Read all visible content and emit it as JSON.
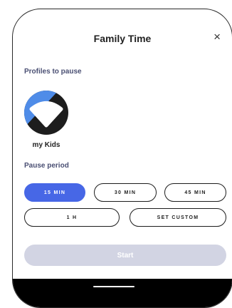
{
  "dialog": {
    "title": "Family Time",
    "close_icon": "×"
  },
  "profiles": {
    "label": "Profiles to pause",
    "items": [
      {
        "name": "my Kids",
        "avatar_icon": "wifi-shield-avatar"
      }
    ]
  },
  "pause": {
    "label": "Pause period",
    "options": [
      {
        "label": "15 MIN",
        "selected": true
      },
      {
        "label": "30 MIN",
        "selected": false
      },
      {
        "label": "45 MIN",
        "selected": false
      },
      {
        "label": "1 H",
        "selected": false
      },
      {
        "label": "SET CUSTOM",
        "selected": false
      }
    ]
  },
  "actions": {
    "start_label": "Start",
    "start_enabled": false
  },
  "colors": {
    "accent": "#4767e6",
    "avatar_blue": "#4f8ce8",
    "disabled_button": "#d2d4e3",
    "section_label": "#4a4f73"
  }
}
